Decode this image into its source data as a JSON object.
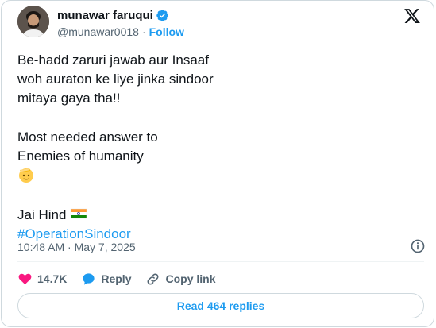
{
  "author": {
    "name": "munawar faruqui",
    "handle": "@munawar0018",
    "separator": "·",
    "follow_label": "Follow",
    "verified_color": "#1d9bf0"
  },
  "tweet": {
    "lines": [
      "Be-hadd zaruri jawab aur Insaaf",
      "woh auraton ke liye jinka sindoor",
      "mitaya gaya tha!!",
      "Most needed answer to",
      "Enemies of humanity",
      "Jai Hind",
      "#OperationSindoor"
    ],
    "emoji_1": "saluting-face-emoji",
    "emoji_2": "india-flag-emoji"
  },
  "meta": {
    "timestamp": "10:48 AM · May 7, 2025"
  },
  "actions": {
    "likes_count": "14.7K",
    "reply_label": "Reply",
    "copy_link_label": "Copy link"
  },
  "replies_button": {
    "label": "Read 464 replies"
  },
  "colors": {
    "accent": "#1d9bf0",
    "like": "#f91880",
    "text": "#0f1419",
    "muted": "#536471"
  },
  "icons": [
    "avatar",
    "verified-badge-icon",
    "x-logo-icon",
    "info-icon",
    "heart-icon",
    "reply-bubble-icon",
    "link-icon"
  ]
}
